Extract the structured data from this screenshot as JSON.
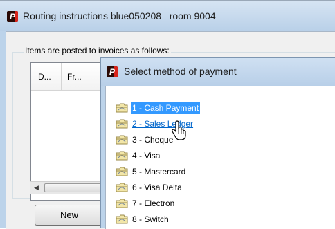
{
  "back_window": {
    "title": "Routing instructions blue050208   room 9004",
    "group_label": "Items are posted to invoices as follows:",
    "columns": [
      "D...",
      "Fr..."
    ],
    "new_button": "New"
  },
  "dialog": {
    "title": "Select method of payment",
    "items": [
      {
        "label": "1 - Cash Payment",
        "state": "selected"
      },
      {
        "label": "2 - Sales Ledger",
        "state": "hover"
      },
      {
        "label": "3 - Cheque",
        "state": "normal"
      },
      {
        "label": "4 - Visa",
        "state": "normal"
      },
      {
        "label": "5 - Mastercard",
        "state": "normal"
      },
      {
        "label": "6 - Visa Delta",
        "state": "normal"
      },
      {
        "label": "7 - Electron",
        "state": "normal"
      },
      {
        "label": "8 - Switch",
        "state": "normal"
      }
    ]
  },
  "colors": {
    "selection": "#3399ff",
    "hover_link": "#0066cc",
    "logo_dark": "#2a0a06",
    "logo_red": "#d8231a"
  },
  "icons": {
    "app_logo": "P",
    "item_icon": "folder-icon",
    "cursor": "hand-pointer-icon"
  }
}
